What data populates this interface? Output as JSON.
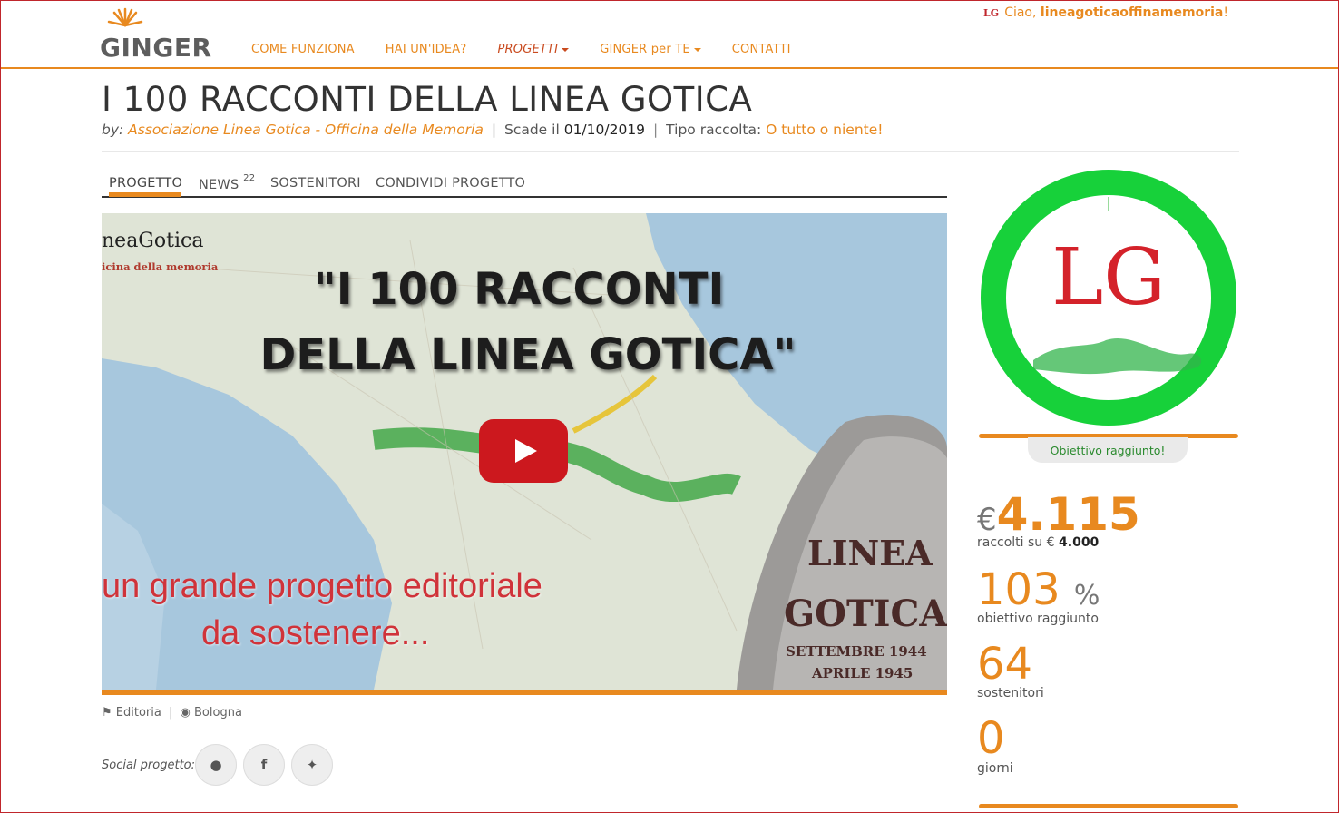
{
  "header": {
    "logo_text": "GINGER",
    "nav": [
      {
        "label": "COME FUNZIONA"
      },
      {
        "label": "HAI UN'IDEA?"
      },
      {
        "label": "PROGETTI"
      },
      {
        "label": "GINGER per TE"
      },
      {
        "label": "CONTATTI"
      }
    ],
    "user_logo": "LG",
    "greeting": "Ciao,",
    "username": "lineagoticaoffinamemoria",
    "greeting_end": "!"
  },
  "project": {
    "title": "I 100 RACCONTI DELLA LINEA GOTICA",
    "by_label": "by:",
    "author": "Associazione Linea Gotica - Officina della Memoria",
    "deadline_label": "Scade il",
    "deadline": "01/10/2019",
    "type_label": "Tipo raccolta:",
    "type_value": "O tutto o niente!"
  },
  "tabs": [
    {
      "label": "PROGETTO"
    },
    {
      "label": "NEWS",
      "count": "22"
    },
    {
      "label": "SOSTENITORI"
    },
    {
      "label": "CONDIVIDI PROGETTO"
    }
  ],
  "video": {
    "logo_line1": "neaGotica",
    "logo_line2": "icina della memoria",
    "headline1": "\"I 100 RACCONTI",
    "headline2": "DELLA LINEA GOTICA\"",
    "red1": "un grande progetto editoriale",
    "red2": "da sostenere...",
    "stone1": "LINEA",
    "stone2": "GOTICA",
    "stone3": "SETTEMBRE 1944",
    "stone4": "APRILE 1945"
  },
  "meta": {
    "category": "Editoria",
    "location": "Bologna"
  },
  "social": {
    "label": "Social progetto:"
  },
  "sidebar": {
    "badge_text": "LG",
    "goal_status": "Obiettivo raggiunto!",
    "currency": "€",
    "raised": "4.115",
    "raised_label": "raccolti su",
    "goal_currency": "€",
    "goal": "4.000",
    "percent": "103",
    "percent_sign": "%",
    "percent_label": "obiettivo raggiunto",
    "backers": "64",
    "backers_label": "sostenitori",
    "days": "0",
    "days_label": "giorni"
  },
  "colors": {
    "accent": "#e8891f",
    "badge_ring": "#17d13a",
    "youtube_red": "#cc181e"
  }
}
